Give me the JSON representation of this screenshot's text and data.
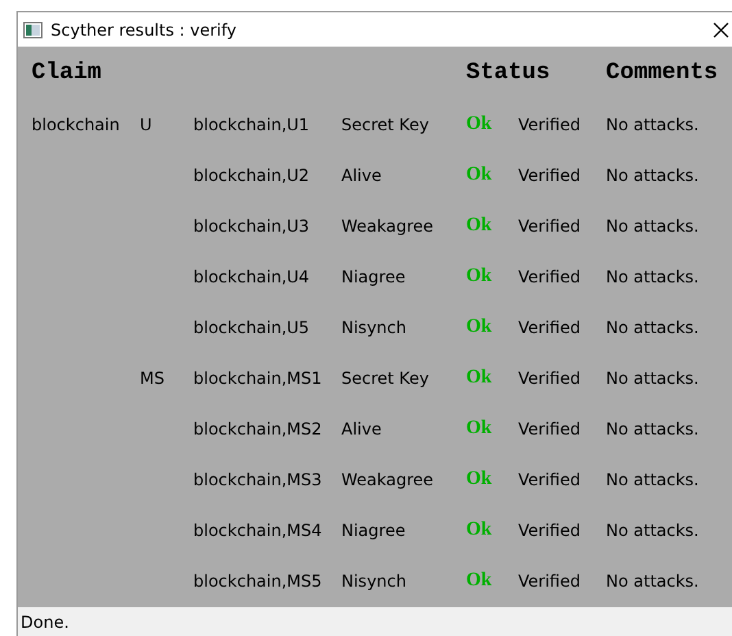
{
  "window": {
    "title": "Scyther results : verify"
  },
  "table": {
    "columns": [
      "Claim",
      "Status",
      "Comments"
    ],
    "rows": [
      {
        "protocol": "blockchain",
        "role": "U",
        "claim": "blockchain,U1",
        "type": "Secret Key",
        "result": "Ok",
        "ok": true,
        "status": "Verified",
        "comment": "No attacks."
      },
      {
        "claim": "blockchain,U2",
        "type": "Alive",
        "result": "Ok",
        "ok": true,
        "status": "Verified",
        "comment": "No attacks."
      },
      {
        "claim": "blockchain,U3",
        "type": "Weakagree",
        "result": "Ok",
        "ok": true,
        "status": "Verified",
        "comment": "No attacks."
      },
      {
        "claim": "blockchain,U4",
        "type": "Niagree",
        "result": "Ok",
        "ok": true,
        "status": "Verified",
        "comment": "No attacks."
      },
      {
        "claim": "blockchain,U5",
        "type": "Nisynch",
        "result": "Ok",
        "ok": true,
        "status": "Verified",
        "comment": "No attacks."
      },
      {
        "role": "MS",
        "claim": "blockchain,MS1",
        "type": "Secret Key",
        "result": "Ok",
        "ok": true,
        "status": "Verified",
        "comment": "No attacks."
      },
      {
        "claim": "blockchain,MS2",
        "type": "Alive",
        "result": "Ok",
        "ok": true,
        "status": "Verified",
        "comment": "No attacks."
      },
      {
        "claim": "blockchain,MS3",
        "type": "Weakagree",
        "result": "Ok",
        "ok": true,
        "status": "Verified",
        "comment": "No attacks."
      },
      {
        "claim": "blockchain,MS4",
        "type": "Niagree",
        "result": "Ok",
        "ok": true,
        "status": "Verified",
        "comment": "No attacks."
      },
      {
        "claim": "blockchain,MS5",
        "type": "Nisynch",
        "result": "Ok",
        "ok": true,
        "status": "Verified",
        "comment": "No attacks."
      }
    ]
  },
  "status_bar": "Done."
}
